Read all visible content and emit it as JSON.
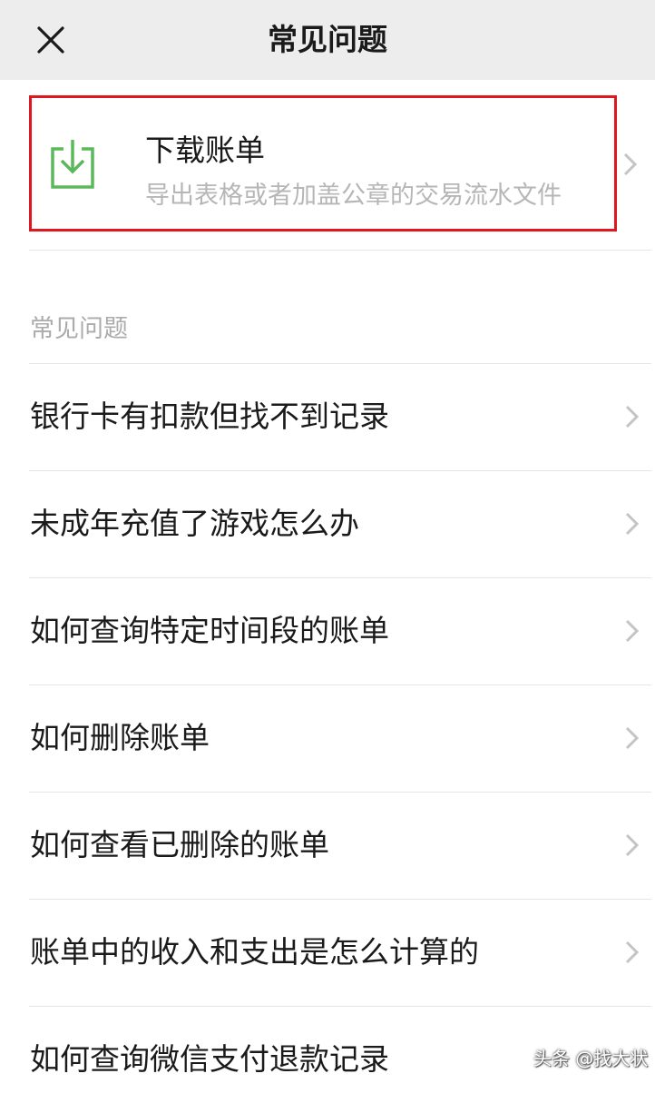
{
  "header": {
    "title": "常见问题",
    "close_icon": "close-icon"
  },
  "download": {
    "title": "下载账单",
    "subtitle": "导出表格或者加盖公章的交易流水文件",
    "icon": "download-icon",
    "icon_color": "#5cb85c",
    "highlight_color": "#e0171f"
  },
  "faq": {
    "section_label": "常见问题",
    "items": [
      {
        "label": "银行卡有扣款但找不到记录"
      },
      {
        "label": "未成年充值了游戏怎么办"
      },
      {
        "label": "如何查询特定时间段的账单"
      },
      {
        "label": "如何删除账单"
      },
      {
        "label": "如何查看已删除的账单"
      },
      {
        "label": "账单中的收入和支出是怎么计算的"
      },
      {
        "label": "如何查询微信支付退款记录"
      }
    ]
  },
  "watermark": {
    "text": "头条 @找大状"
  }
}
